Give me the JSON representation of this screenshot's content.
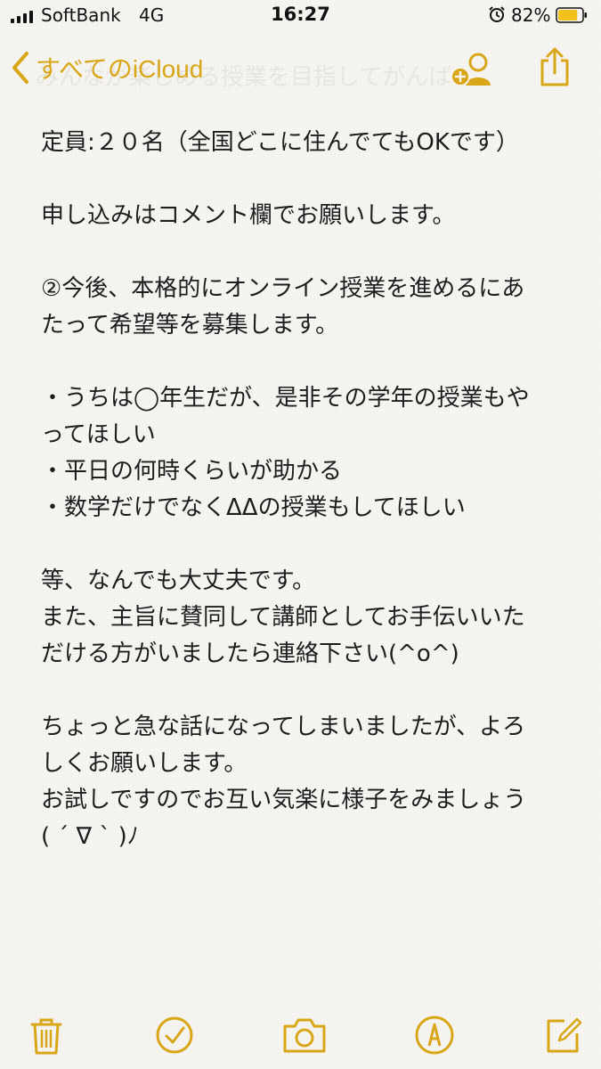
{
  "status_bar": {
    "carrier": "SoftBank",
    "network": "4G",
    "time": "16:27",
    "battery_percent": "82%",
    "battery_level": 0.82,
    "icons": [
      "signal-icon",
      "alarm-icon",
      "battery-icon"
    ]
  },
  "nav": {
    "back_label": "すべてのiCloud",
    "obscured_heading": "みんなが楽しめる授業を目指してがんば",
    "icons": [
      "chevron-left-icon",
      "add-person-icon",
      "share-icon"
    ]
  },
  "note": {
    "lines": [
      "定員:２０名（全国どこに住んでてもOKです）",
      "",
      "申し込みはコメント欄でお願いします。",
      "",
      "②今後、本格的にオンライン授業を進めるにあ",
      "たって希望等を募集します。",
      "",
      "・うちは◯年生だが、是非その学年の授業もや",
      "ってほしい",
      "・平日の何時くらいが助かる",
      "・数学だけでなくΔΔの授業もしてほしい",
      "",
      "等、なんでも大丈夫です。",
      "また、主旨に賛同して講師としてお手伝いいた",
      "だける方がいましたら連絡下さい(^o^)",
      "",
      "ちょっと急な話になってしまいましたが、よろ",
      "しくお願いします。",
      "お試しですのでお互い気楽に様子をみましょう",
      "( ´ ∇ ` )ﾉ"
    ]
  },
  "toolbar": {
    "icons": [
      "trash-icon",
      "checklist-icon",
      "camera-icon",
      "markup-pen-icon",
      "compose-icon"
    ]
  },
  "colors": {
    "accent": "#d9a617",
    "text": "#1d1d1d",
    "background": "#f6f5f2"
  }
}
